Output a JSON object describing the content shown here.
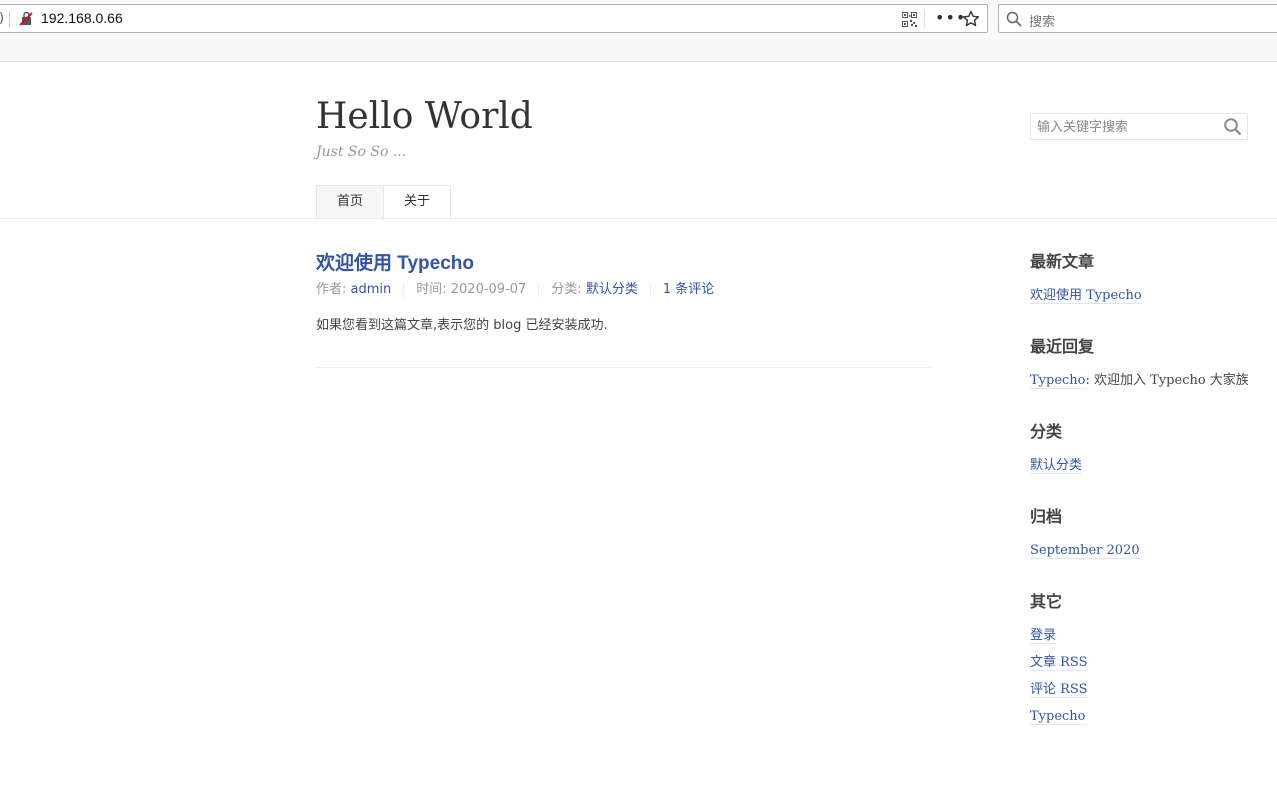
{
  "browser": {
    "url": "192.168.0.66",
    "url_left_glyph": ")",
    "search_placeholder": "搜索",
    "more_label": "•••"
  },
  "site": {
    "title": "Hello World",
    "description": "Just So So ...",
    "search_placeholder": "输入关键字搜索"
  },
  "nav": {
    "items": [
      {
        "label": "首页",
        "active": true
      },
      {
        "label": "关于",
        "active": false
      }
    ]
  },
  "post": {
    "title": "欢迎使用 Typecho",
    "author_label": "作者: ",
    "author": "admin",
    "time": "时间: 2020-09-07",
    "category_label": "分类: ",
    "category": "默认分类",
    "comments": "1 条评论",
    "content": "如果您看到这篇文章,表示您的 blog 已经安装成功."
  },
  "sidebar": {
    "recent_posts": {
      "title": "最新文章",
      "items": [
        "欢迎使用 Typecho"
      ]
    },
    "recent_comments": {
      "title": "最近回复",
      "author": "Typecho",
      "text": ": 欢迎加入 Typecho 大家族"
    },
    "categories": {
      "title": "分类",
      "items": [
        "默认分类"
      ]
    },
    "archives": {
      "title": "归档",
      "items": [
        "September 2020"
      ]
    },
    "misc": {
      "title": "其它",
      "items": [
        "登录",
        "文章 RSS",
        "评论 RSS",
        "Typecho"
      ]
    }
  },
  "colors": {
    "link": "#3354aa",
    "text": "#444444",
    "muted": "#999999"
  }
}
